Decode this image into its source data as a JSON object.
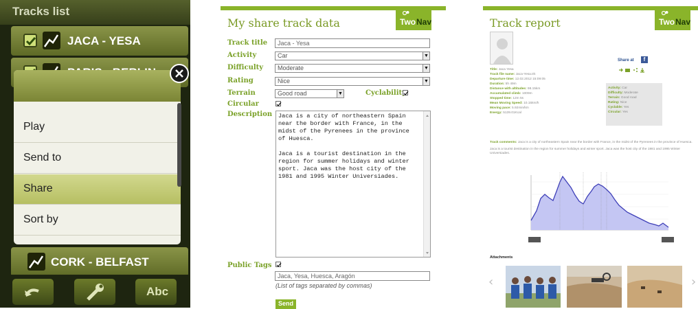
{
  "device": {
    "title": "Tracks list",
    "tracks": [
      {
        "name": "JACA - YESA",
        "checked": true
      },
      {
        "name": "PARIS - BERLIN",
        "checked": true
      },
      {
        "name": "CORK - BELFAST",
        "checked": false
      }
    ],
    "menu": {
      "items": [
        "Play",
        "Send to",
        "Share",
        "Sort by"
      ],
      "selected": "Share"
    },
    "bottom_buttons": {
      "undo": "undo-icon",
      "tools": "wrench-icon",
      "abc": "Abc"
    }
  },
  "form": {
    "title": "My share track data",
    "logo": {
      "text1": "Two",
      "text2": "Nav"
    },
    "fields": {
      "track_title_label": "Track title",
      "track_title_value": "Jaca - Yesa",
      "activity_label": "Activity",
      "activity_value": "Car",
      "difficulty_label": "Difficulty",
      "difficulty_value": "Moderate",
      "rating_label": "Rating",
      "rating_value": "Nice",
      "terrain_label": "Terrain",
      "terrain_value": "Good road",
      "cyclability_label": "Cyclability",
      "circular_label": "Circular",
      "description_label": "Description",
      "description_value": "Jaca is a city of northeastern Spain\nnear the border with France, in the\nmidst of the Pyrenees in the province\nof Huesca.\n\nJaca is a tourist destination in the\nregion for summer holidays and winter\nsport. Jaca was the host city of the\n1981 and 1995 Winter Universiades.",
      "public_tags_label": "Public Tags",
      "tags_value": "Jaca, Yesa, Huesca, Aragón",
      "tags_hint": "(List of tags separated by commas)"
    },
    "send_label": "Send"
  },
  "report": {
    "title": "Track report",
    "logo": {
      "text1": "Two",
      "text2": "Nav"
    },
    "share_label": "Share at",
    "meta_left": [
      {
        "k": "Title:",
        "v": "Jaca Yesa"
      },
      {
        "k": "Track file name:",
        "v": "Jaca-Yesa.trk"
      },
      {
        "k": "Departure time:",
        "v": "12.02.2012 15:09:05"
      },
      {
        "k": "Duration:",
        "v": "5h 49m"
      },
      {
        "k": "Distance with altitudes:",
        "v": "98.15km"
      },
      {
        "k": "Accumulated climb:",
        "v": "1009m"
      },
      {
        "k": "Stopped time:",
        "v": "12m 5s"
      },
      {
        "k": "Mean Moving Speed:",
        "v": "10.15km/h"
      },
      {
        "k": "Moving pace:",
        "v": "5.92min/km"
      },
      {
        "k": "Energy:",
        "v": "5139.01Kcal"
      }
    ],
    "meta_right": [
      {
        "k": "Activity:",
        "v": "Car"
      },
      {
        "k": "Difficulty:",
        "v": "Moderate"
      },
      {
        "k": "Terrain:",
        "v": "Good road"
      },
      {
        "k": "Rating:",
        "v": "Nice"
      },
      {
        "k": "Cyclable:",
        "v": "Yes"
      },
      {
        "k": "Circular:",
        "v": "Yes"
      }
    ],
    "comments_label": "Track comments:",
    "comments_1": "Jaca is a city of northeastern Spain near the border with France, in the midst of the Pyrenees in the province of Huesca.",
    "comments_2": "Jaca is a tourist destination in the region for summer holidays and winter sport. Jaca was the host city of the 1981 and 1995 Winter Universiades.",
    "attachments_label": "Attachments"
  },
  "colors": {
    "brand_green": "#8ab42a",
    "label_green": "#7aa128",
    "device_bg": "#1e2510",
    "menu_selected": "#c2ca72"
  }
}
